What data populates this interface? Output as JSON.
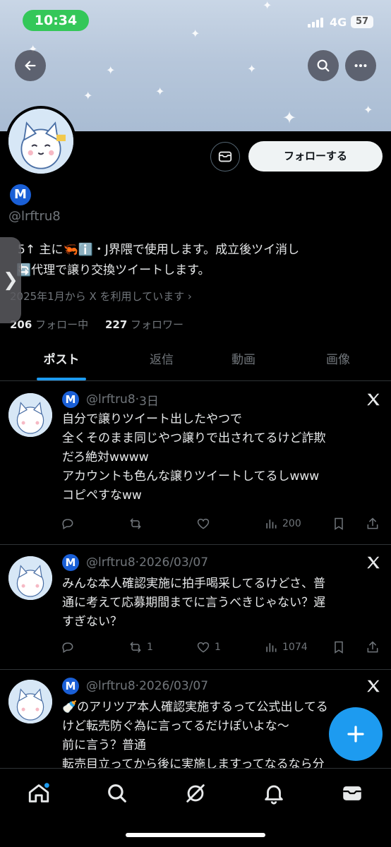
{
  "status": {
    "time": "10:34",
    "network": "4G",
    "battery": "57"
  },
  "profile": {
    "badge_letter": "M",
    "handle": "@lrftru8",
    "follow_label": "フォローする",
    "bio_line1": "5↑ 主に🦐ℹ️・J界隈で使用します。成立後ツイ消し",
    "bio_line2": "🔄代理で譲り交換ツイートします。",
    "joined": "2025年1月から X を利用しています",
    "following_count": "206",
    "following_label": "フォロー中",
    "followers_count": "227",
    "followers_label": "フォロワー"
  },
  "tabs": [
    "ポスト",
    "返信",
    "動画",
    "画像"
  ],
  "posts": [
    {
      "handle": "@lrftru8",
      "time": "3日",
      "lines": [
        "自分で譲りツイート出したやつで",
        "全くそのまま同じやつ譲りで出されてるけど詐欺",
        "だろ絶対wwww",
        "アカウントも色んな譲りツイートしてるしwww",
        "コピペすなww"
      ],
      "replies": "",
      "reposts": "",
      "likes": "",
      "views": "200"
    },
    {
      "handle": "@lrftru8",
      "time": "2026/03/07",
      "lines": [
        "みんな本人確認実施に拍手喝采してるけどさ、普",
        "通に考えて応募期間までに言うべきじゃない？遅",
        "すぎない？"
      ],
      "replies": "",
      "reposts": "1",
      "likes": "1",
      "views": "1074"
    },
    {
      "handle": "@lrftru8",
      "time": "2026/03/07",
      "lines": [
        "🍼のアリツア本人確認実施するって公式出してる",
        "けど転売防ぐ為に言ってるだけぽいよな〜",
        "前に言う？普通",
        "転売目立ってから後に実施しますってなるなら分"
      ],
      "replies": "",
      "reposts": "",
      "likes": "",
      "views": ""
    }
  ],
  "colors": {
    "accent": "#1d9bf0",
    "badge": "#1a5fd6",
    "muted": "#71767b",
    "status_pill": "#34c759"
  },
  "icons": {
    "back": "arrow-left-icon",
    "search": "search-icon",
    "more": "more-icon",
    "messages": "envelope-icon",
    "x": "x-logo-icon"
  }
}
